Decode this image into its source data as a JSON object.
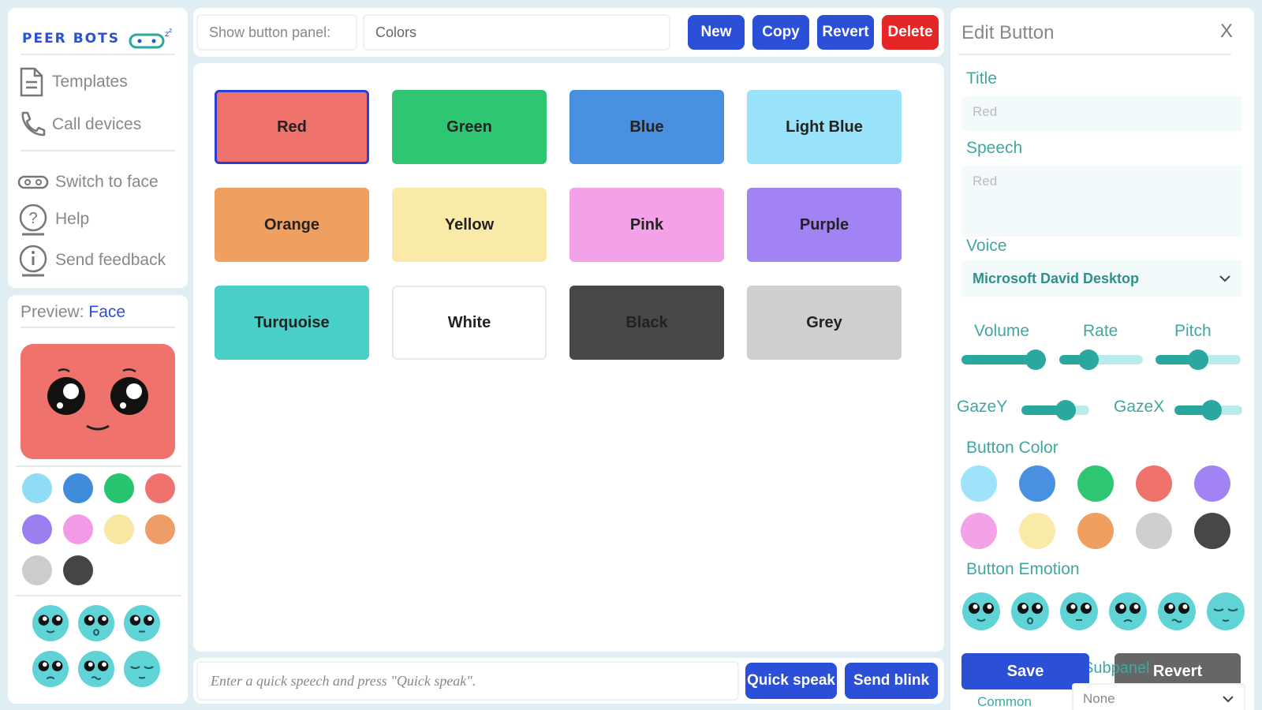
{
  "nav": {
    "logo": "PEER BOTS",
    "items": [
      {
        "icon": "document-icon",
        "label": "Templates"
      },
      {
        "icon": "phone-icon",
        "label": "Call devices"
      },
      {
        "icon": "robot-face-icon",
        "label": "Switch to face"
      },
      {
        "icon": "help-icon",
        "label": "Help"
      },
      {
        "icon": "info-icon",
        "label": "Send feedback"
      }
    ]
  },
  "preview": {
    "label": "Preview:",
    "mode": "Face",
    "face_color": "#f0726c",
    "swatches": [
      "#8fdcf7",
      "#3f8cdb",
      "#27c46f",
      "#f0726c",
      "#9b7ff0",
      "#f29ae6",
      "#f8e7a2",
      "#ee9d66",
      "#cccccc",
      "#454545"
    ],
    "emotion_color": "#5fd3d6"
  },
  "topbar": {
    "show_label": "Show button panel:",
    "panel_value": "Colors",
    "buttons": [
      {
        "label": "New",
        "color": "#2b4fd6"
      },
      {
        "label": "Copy",
        "color": "#2b4fd6"
      },
      {
        "label": "Revert",
        "color": "#2b4fd6"
      },
      {
        "label": "Delete",
        "color": "#e52626"
      }
    ]
  },
  "grid": {
    "buttons": [
      {
        "label": "Red",
        "color": "#f0726c",
        "selected": true
      },
      {
        "label": "Green",
        "color": "#2ec673"
      },
      {
        "label": "Blue",
        "color": "#4a90e0"
      },
      {
        "label": "Light Blue",
        "color": "#98e2fa"
      },
      {
        "label": "Orange",
        "color": "#efa060"
      },
      {
        "label": "Yellow",
        "color": "#faeaa8"
      },
      {
        "label": "Pink",
        "color": "#f4a2e8"
      },
      {
        "label": "Purple",
        "color": "#a283f4"
      },
      {
        "label": "Turquoise",
        "color": "#48cfc8"
      },
      {
        "label": "White",
        "color": "#ffffff"
      },
      {
        "label": "Black",
        "color": "#474747"
      },
      {
        "label": "Grey",
        "color": "#cfcfcf"
      }
    ]
  },
  "bottombar": {
    "placeholder": "Enter a quick speech and press \"Quick speak\".",
    "quick_speak": "Quick speak",
    "send_blink": "Send blink"
  },
  "edit": {
    "title": "Edit Button",
    "close": "X",
    "title_label": "Title",
    "title_value": "Red",
    "speech_label": "Speech",
    "speech_value": "Red",
    "voice_label": "Voice",
    "voice_value": "Microsoft David Desktop",
    "volume_label": "Volume",
    "rate_label": "Rate",
    "pitch_label": "Pitch",
    "gazey_label": "GazeY",
    "gazex_label": "GazeX",
    "volume": 0.9,
    "rate": 0.35,
    "pitch": 0.5,
    "gazey": 0.65,
    "gazex": 0.55,
    "color_label": "Button Color",
    "colors": [
      "#9fe3fa",
      "#4a90e0",
      "#2ec673",
      "#f0726c",
      "#a283f4",
      "#f4a2e8",
      "#faeaa8",
      "#efa060",
      "#cfcfcf",
      "#474747"
    ],
    "emotion_label": "Button Emotion",
    "save": "Save",
    "revert": "Revert",
    "subpanel_label": "Subpanel",
    "subpanel_value": "None",
    "common_label": "Common"
  }
}
